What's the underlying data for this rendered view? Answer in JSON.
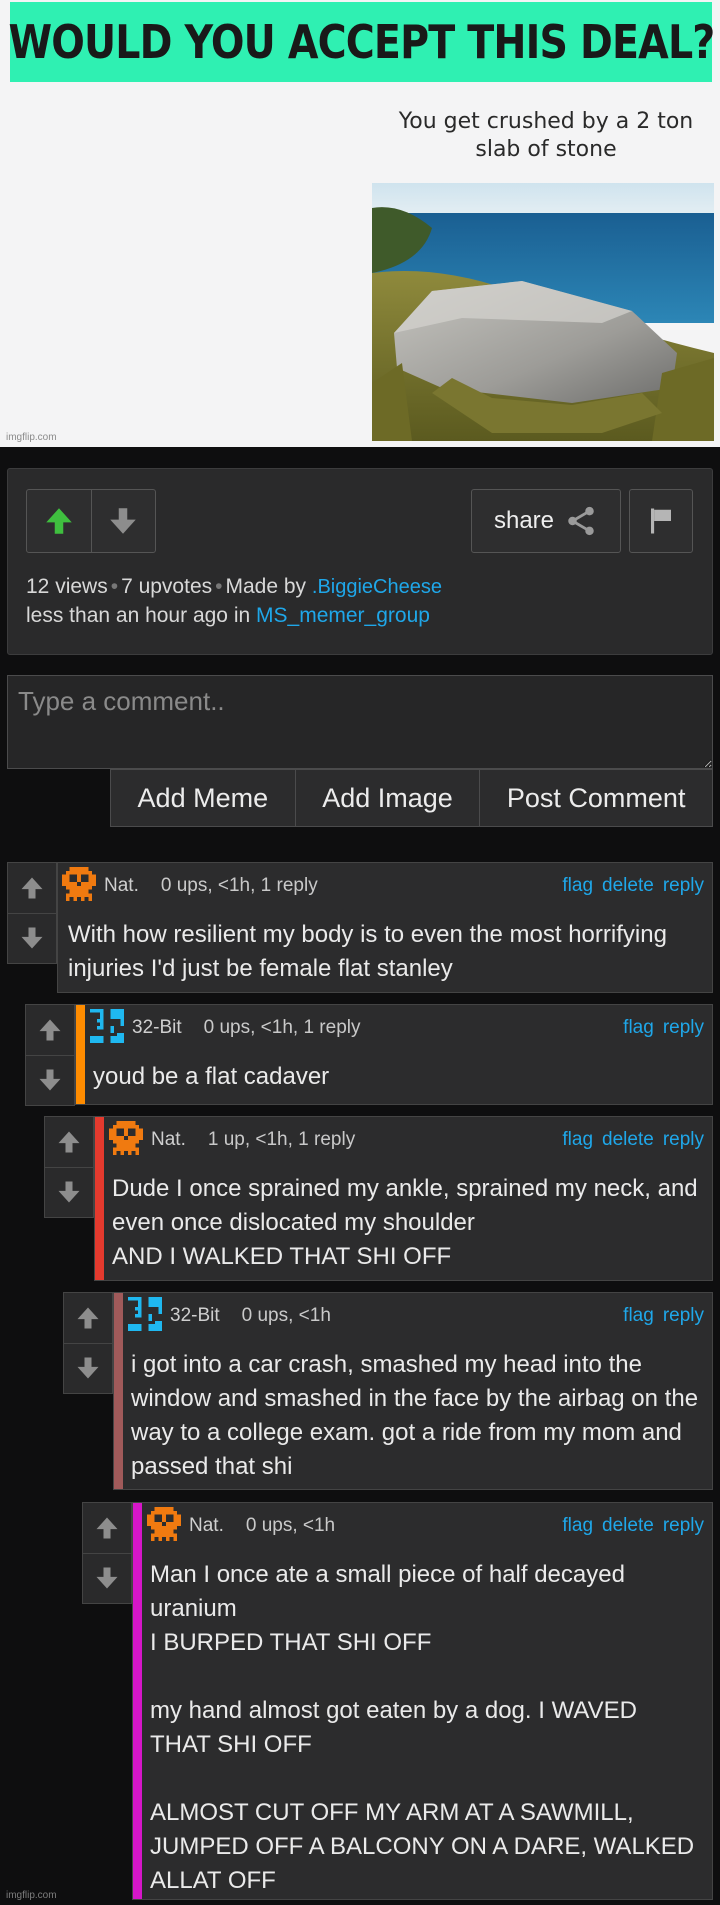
{
  "meme": {
    "title": "WOULD YOU ACCEPT THIS DEAL?",
    "caption": "You get crushed by a 2 ton slab of stone",
    "watermark": "imgflip.com"
  },
  "post": {
    "share_label": "share",
    "views": "12 views",
    "upvotes": "7 upvotes",
    "made_by_prefix": "Made by",
    "author": ".BiggieCheese",
    "time_prefix": "less than an hour ago in",
    "stream": "MS_memer_group",
    "upvote_color": "#3fbf3f"
  },
  "comment_form": {
    "placeholder": "Type a comment..",
    "buttons": [
      "Add Meme",
      "Add Image",
      "Post Comment"
    ]
  },
  "comments": [
    {
      "user": "Nat.",
      "meta": "0 ups, <1h, 1 reply",
      "links": [
        "flag",
        "delete",
        "reply"
      ],
      "text": "With how resilient my body is to even the most horrifying injuries I'd just be female flat stanley",
      "bar_color": "",
      "avatar": "skull-avatar"
    },
    {
      "user": "32-Bit",
      "meta": "0 ups, <1h, 1 reply",
      "links": [
        "flag",
        "reply"
      ],
      "text": "youd be a flat cadaver",
      "bar_color": "#ff8c00",
      "avatar": "32-avatar"
    },
    {
      "user": "Nat.",
      "meta": "1 up, <1h, 1 reply",
      "links": [
        "flag",
        "delete",
        "reply"
      ],
      "text": "Dude I once sprained my ankle, sprained my neck, and even once dislocated my shoulder\nAND I WALKED THAT SHI OFF",
      "bar_color": "#e43a2e",
      "avatar": "skull-avatar"
    },
    {
      "user": "32-Bit",
      "meta": "0 ups, <1h",
      "links": [
        "flag",
        "reply"
      ],
      "text": "i got into a car crash, smashed my head into the window and smashed in the face by the airbag on the way to a college exam. got a ride from my mom and passed that shi",
      "bar_color": "#a05a5a",
      "avatar": "32-avatar"
    },
    {
      "user": "Nat.",
      "meta": "0 ups, <1h",
      "links": [
        "flag",
        "delete",
        "reply"
      ],
      "text": "Man I once ate a small piece of half decayed uranium\nI BURPED THAT SHI OFF\n\nmy hand almost got eaten by a dog. I WAVED THAT SHI OFF\n\nALMOST CUT OFF MY ARM AT A SAWMILL, JUMPED OFF A BALCONY ON A DARE, WALKED ALLAT OFF",
      "bar_color": "#d616c9",
      "avatar": "skull-avatar"
    }
  ],
  "footer": {
    "watermark": "imgflip.com"
  }
}
